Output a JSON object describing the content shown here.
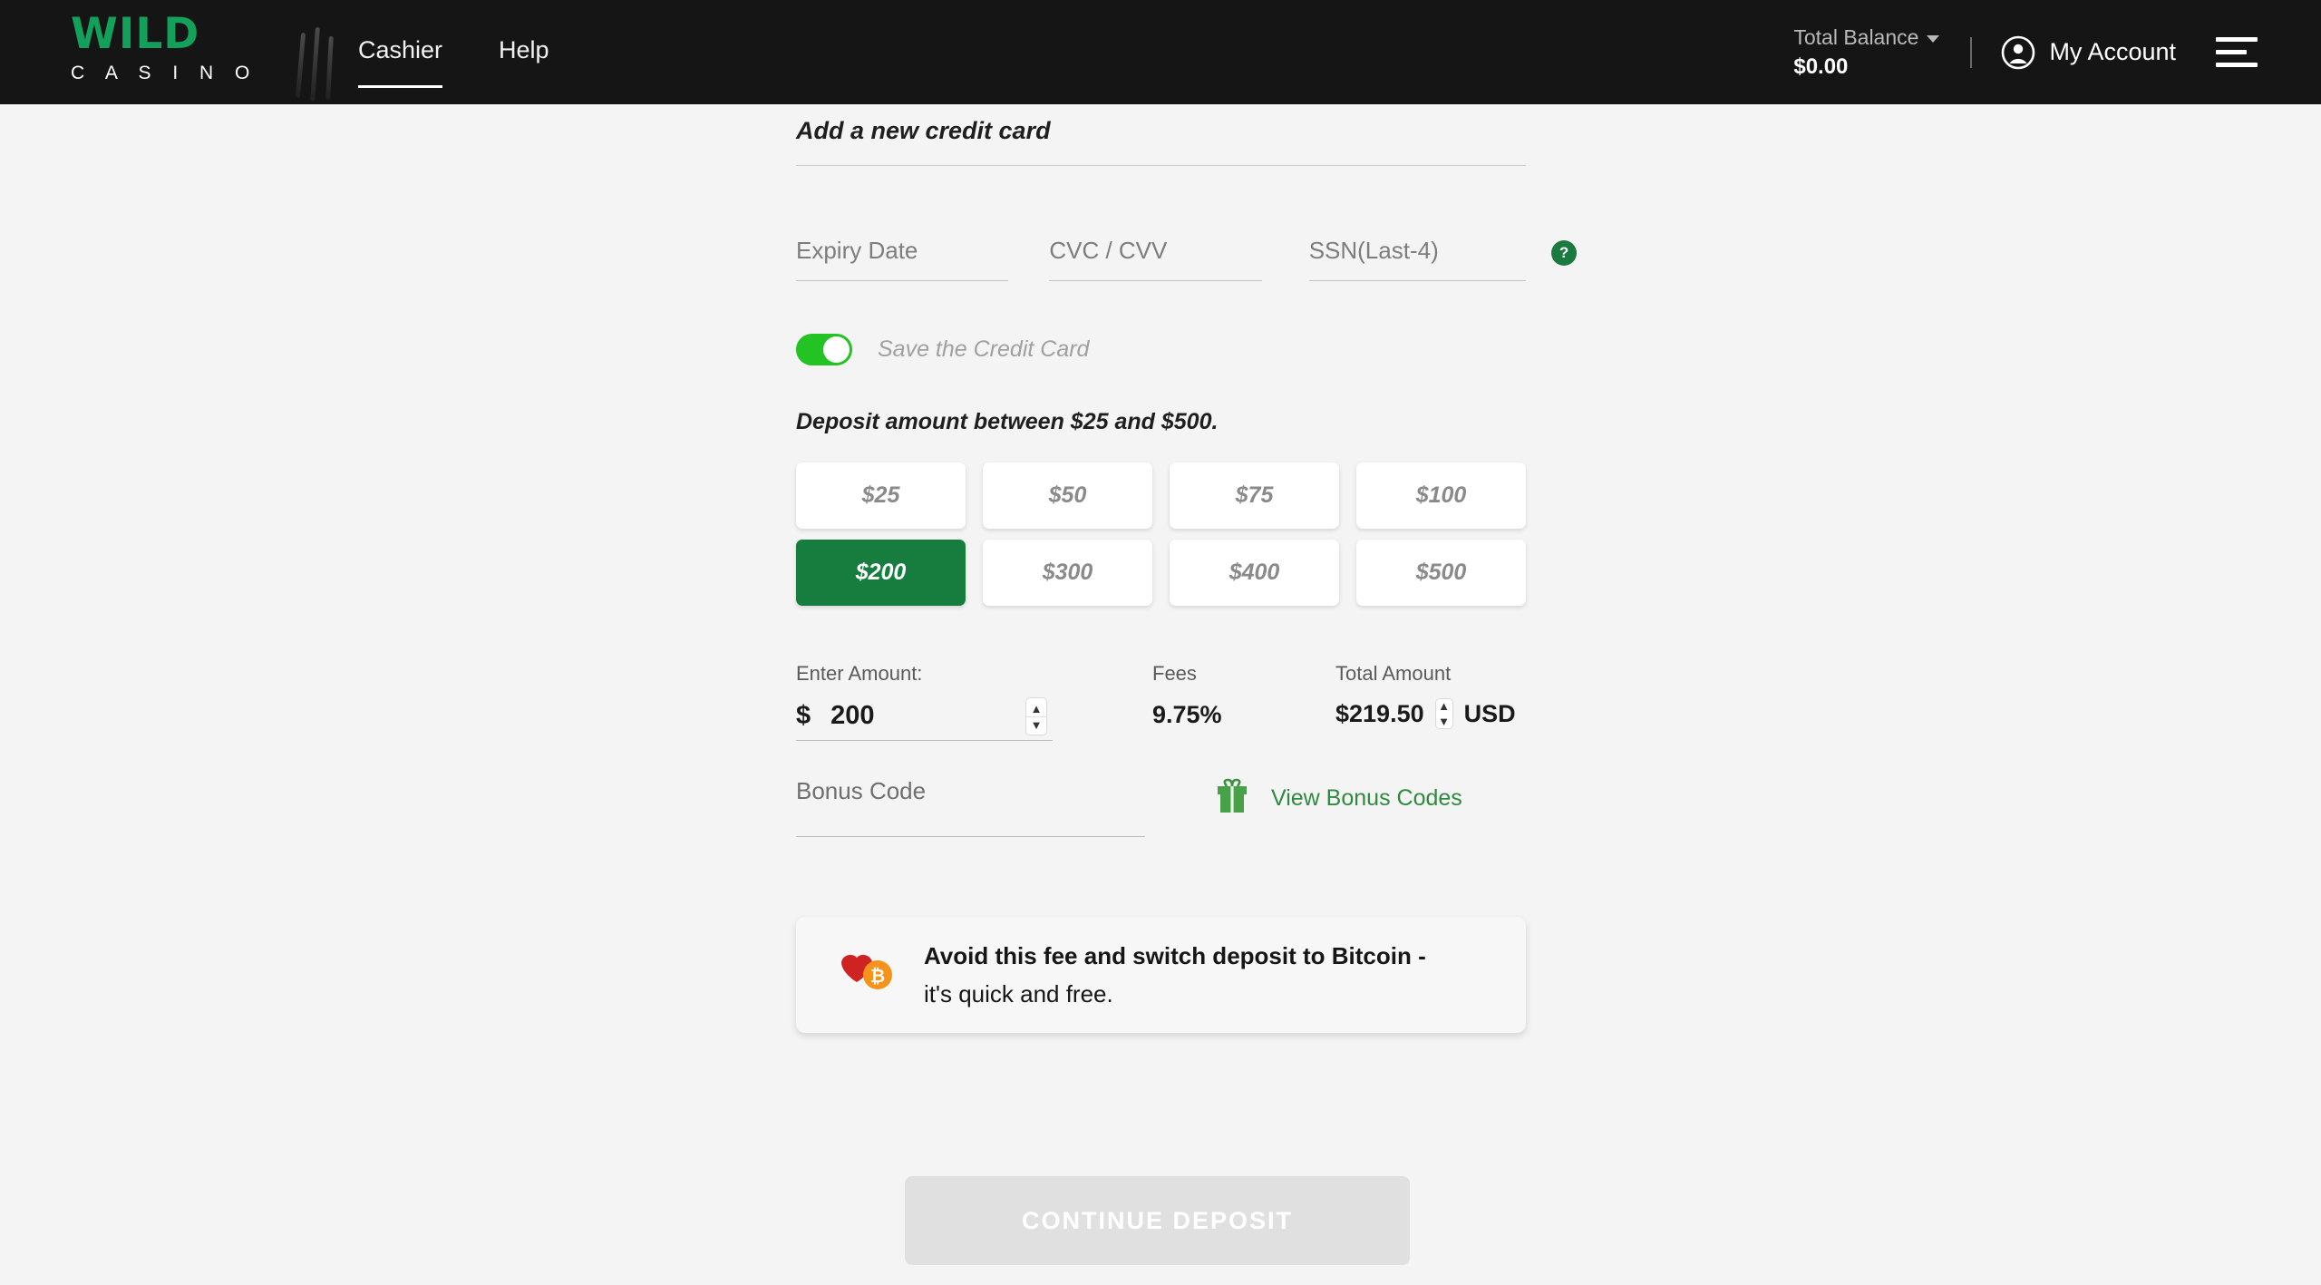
{
  "header": {
    "logo_primary": "WILD",
    "logo_secondary": "C A S I N O",
    "nav": [
      {
        "label": "Cashier",
        "active": true
      },
      {
        "label": "Help",
        "active": false
      }
    ],
    "balance_label": "Total Balance",
    "balance_value": "$0.00",
    "account_label": "My Account",
    "icons": {
      "chevron": "chevron-down-icon",
      "avatar": "avatar-icon",
      "menu": "hamburger-menu-icon"
    }
  },
  "form": {
    "section_title": "Add a new credit card",
    "fields": {
      "expiry_placeholder": "Expiry Date",
      "expiry_value": "",
      "cvc_placeholder": "CVC / CVV",
      "cvc_value": "",
      "ssn_placeholder": "SSN(Last-4)",
      "ssn_value": "",
      "help_badge": "?"
    },
    "save_card_label": "Save the Credit Card",
    "save_card_on": true,
    "deposit_note": "Deposit amount between $25 and $500.",
    "amount_options": [
      "$25",
      "$50",
      "$75",
      "$100",
      "$200",
      "$300",
      "$400",
      "$500"
    ],
    "selected_amount": "$200",
    "enter_amount_label": "Enter Amount:",
    "currency_symbol": "$",
    "amount_value": "200",
    "fees_label": "Fees",
    "fees_value": "9.75%",
    "total_label": "Total Amount",
    "total_value": "$219.50",
    "currency_code": "USD",
    "bonus_placeholder": "Bonus Code",
    "bonus_value": "",
    "bonus_link": "View Bonus Codes",
    "gift_icon": "gift-icon"
  },
  "banner": {
    "line1": "Avoid this fee and switch deposit to Bitcoin -",
    "line2": "it's quick and free.",
    "heart_icon": "heart-icon",
    "bitcoin_icon": "bitcoin-icon"
  },
  "footer": {
    "continue_label": "CONTINUE DEPOSIT"
  },
  "colors": {
    "header_bg": "#151515",
    "page_bg": "#f4f4f4",
    "brand_green": "#12a05a",
    "selected_green": "#177d3f",
    "toggle_green": "#22c322",
    "link_green": "#2f8a3e",
    "bitcoin_orange": "#f7931a",
    "heart_red": "#cf2222",
    "disabled_gray": "#e0e0e0"
  }
}
